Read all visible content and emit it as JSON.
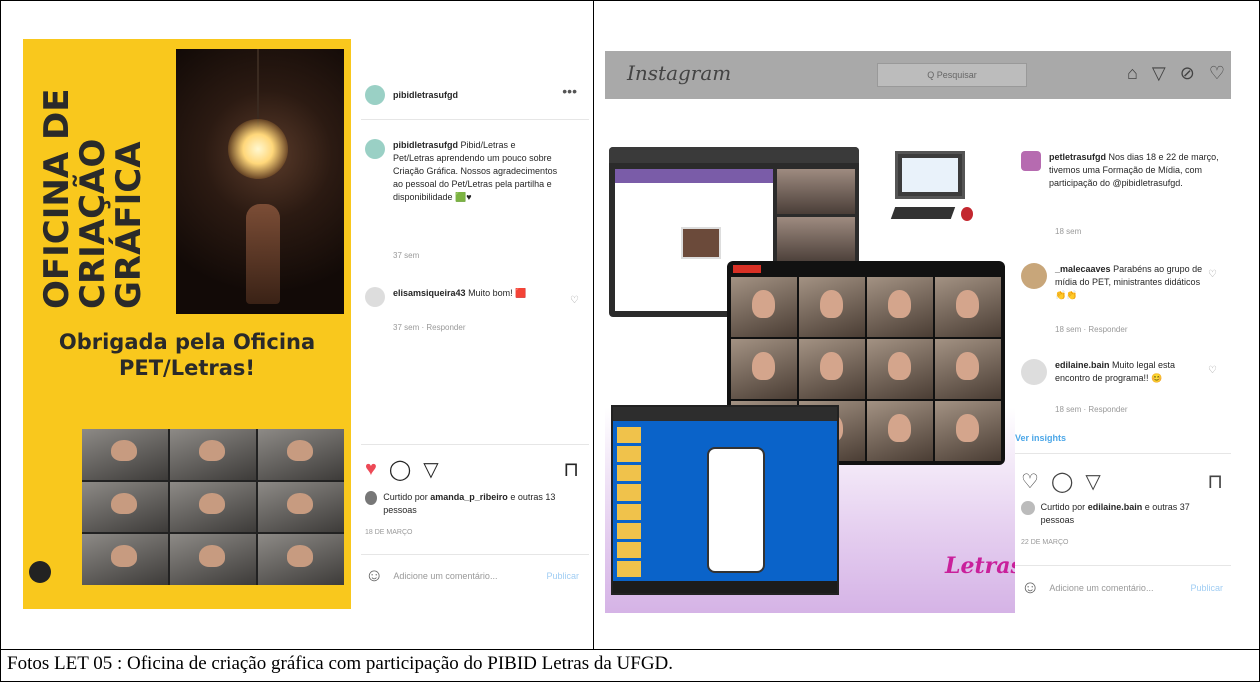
{
  "caption": "Fotos LET 05 : Oficina de criação gráfica com participação do PIBID Letras da UFGD.",
  "left_post": {
    "banner_lines": [
      "OFICINA DE",
      "CRIAÇÃO",
      "GRÁFICA"
    ],
    "thanks_line1": "Obrigada pela Oficina",
    "thanks_line2": "PET/Letras!",
    "username": "pibidletrasufgd",
    "more_icon": "•••",
    "caption_user": "pibidletrasufgd",
    "caption_text": "Pibid/Letras e Pet/Letras aprendendo um pouco sobre Criação Gráfica. Nossos agradecimentos ao pessoal do Pet/Letras pela partilha e disponibilidade 🟩♥",
    "caption_time": "37 sem",
    "comment_user": "elisamsiqueira43",
    "comment_text": "Muito bom! 🟥",
    "comment_meta": "37 sem · Responder",
    "liked_prefix": "Curtido por",
    "liked_user": "amanda_p_ribeiro",
    "liked_suffix": "e outras 13 pessoas",
    "date": "18 DE MARÇO",
    "add_comment_placeholder": "Adicione um comentário...",
    "publish_label": "Publicar"
  },
  "right_post": {
    "ig_logo": "Instagram",
    "search_placeholder": "Q Pesquisar",
    "caption_user": "petletrasufgd",
    "caption_text": "Nos dias 18 e 22 de março, tivemos uma Formação de Mídia, com participação do @pibidletrasufgd.",
    "caption_time": "18 sem",
    "comment1_user": "_malecaaves",
    "comment1_text": "Parabéns ao grupo de mídia do PET, ministrantes didáticos 👏👏",
    "comment1_meta": "18 sem · Responder",
    "comment2_user": "edilaine.bain",
    "comment2_text": "Muito legal esta encontro de programa!! 😊",
    "comment2_meta": "18 sem · Responder",
    "insights_link": "Ver insights",
    "liked_prefix": "Curtido por",
    "liked_user": "edilaine.bain",
    "liked_suffix": "e outras 37 pessoas",
    "date": "22 DE MARÇO",
    "add_comment_placeholder": "Adicione um comentário...",
    "publish_label": "Publicar",
    "brand_logo": "Letras"
  },
  "icons": {
    "like_filled": "heart-icon",
    "comment": "comment-icon",
    "share": "share-icon",
    "save": "bookmark-icon",
    "home": "home-icon",
    "explore": "compass-icon",
    "accent_red": "#ed4956",
    "accent_yellow": "#f9c81d"
  }
}
